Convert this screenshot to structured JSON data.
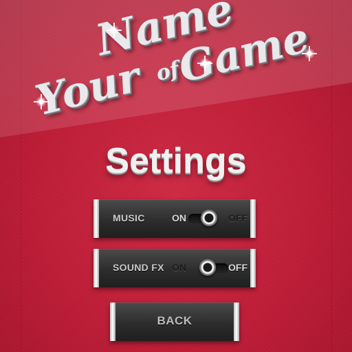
{
  "logo": {
    "line1": "Name",
    "connector": "of",
    "line2a": "Your",
    "line2b": "Game"
  },
  "screen": {
    "title": "Settings"
  },
  "settings": {
    "music": {
      "label": "MUSIC",
      "on_label": "ON",
      "off_label": "OFF",
      "state": "on"
    },
    "sound_fx": {
      "label": "SOUND FX",
      "on_label": "ON",
      "off_label": "OFF",
      "state": "off"
    }
  },
  "buttons": {
    "back_label": "BACK"
  },
  "colors": {
    "background": "#c1203a",
    "panel": "#2d2d2d",
    "panel_cap": "#ffffff",
    "logo_text": "#e9e9ec"
  },
  "icons": [
    "sparkle-icon",
    "toggle-knob-icon"
  ]
}
